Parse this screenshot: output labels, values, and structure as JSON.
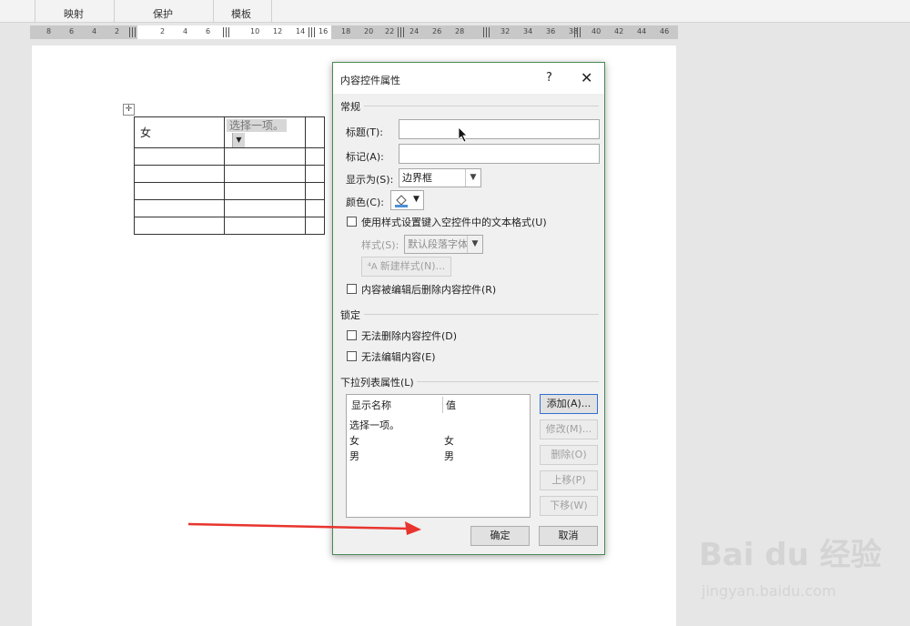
{
  "ribbon": {
    "groups": [
      "映射",
      "保护",
      "模板"
    ]
  },
  "ruler": {
    "ticks": [
      "8",
      "6",
      "4",
      "2",
      "2",
      "4",
      "6",
      "10",
      "12",
      "14",
      "16",
      "18",
      "20",
      "22",
      "24",
      "26",
      "28",
      "32",
      "34",
      "36",
      "38",
      "40",
      "42",
      "44",
      "46"
    ]
  },
  "doc_table": {
    "cell1": "女",
    "cc_placeholder": "选择一项。",
    "dd_arrow": "▼"
  },
  "dialog": {
    "title": "内容控件属性",
    "help": "?",
    "close": "✕",
    "general_section": "常规",
    "title_label": "标题(T):",
    "tag_label": "标记(A):",
    "show_as_label": "显示为(S):",
    "show_as_value": "边界框",
    "color_label": "颜色(C):",
    "use_style_label": "使用样式设置键入空控件中的文本格式(U)",
    "style_label": "样式(S):",
    "style_value": "默认段落字体",
    "new_style_button": "新建样式(N)...",
    "remove_when_edited_label": "内容被编辑后删除内容控件(R)",
    "locking_section": "锁定",
    "cannot_delete_label": "无法删除内容控件(D)",
    "cannot_edit_label": "无法编辑内容(E)",
    "dropdown_section": "下拉列表属性(L)",
    "list": {
      "col_display": "显示名称",
      "col_value": "值",
      "rows": [
        {
          "display": "选择一项。",
          "value": ""
        },
        {
          "display": "女",
          "value": "女"
        },
        {
          "display": "男",
          "value": "男"
        }
      ]
    },
    "add_button": "添加(A)...",
    "modify_button": "修改(M)...",
    "delete_button": "删除(O)",
    "move_up_button": "上移(P)",
    "move_down_button": "下移(W)",
    "ok_button": "确定",
    "cancel_button": "取消"
  },
  "watermark": {
    "brand": "Bai du 经验",
    "url": "jingyan.baidu.com"
  },
  "colors": {
    "arrow": "#e8342e",
    "dialog_border": "#4a8a52",
    "default_button_border": "#2f6fd0"
  }
}
